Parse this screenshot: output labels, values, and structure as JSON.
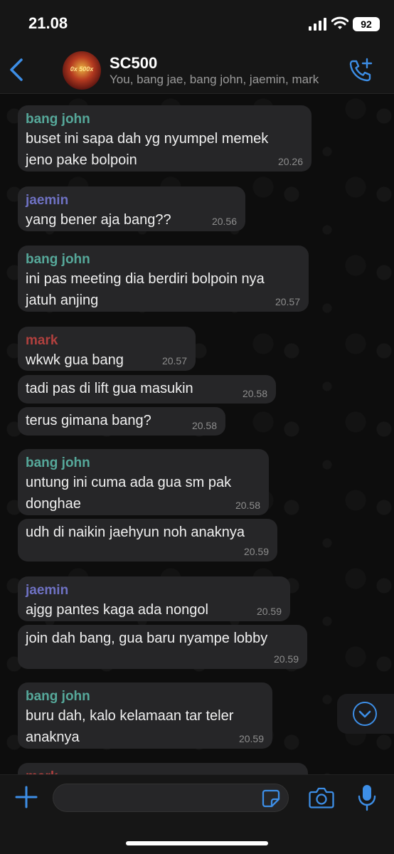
{
  "status_bar": {
    "time": "21.08",
    "battery": "92"
  },
  "header": {
    "back_icon": "chevron-left-icon",
    "avatar_text": "0x 500x",
    "title": "SC500",
    "members": "You, bang jae, bang john, jaemin, mark",
    "call_icon": "phone-plus-icon"
  },
  "messages": [
    {
      "sender": "bang john",
      "lines": [
        "buset ini sapa dah yg nyumpel memek",
        "jeno pake bolpoin"
      ],
      "time": "20.26"
    },
    {
      "sender": "jaemin",
      "lines": [
        "yang bener aja bang??"
      ],
      "time": "20.56"
    },
    {
      "sender": "bang john",
      "lines": [
        "ini pas meeting dia berdiri bolpoin nya",
        "jatuh anjing"
      ],
      "time": "20.57"
    },
    {
      "sender": "mark",
      "lines": [
        "wkwk gua bang"
      ],
      "time": "20.57"
    },
    {
      "sender": "",
      "lines": [
        "tadi pas di lift gua masukin"
      ],
      "time": "20.58"
    },
    {
      "sender": "",
      "lines": [
        "terus gimana bang?"
      ],
      "time": "20.58"
    },
    {
      "sender": "bang john",
      "lines": [
        "untung ini cuma ada gua sm pak",
        "donghae"
      ],
      "time": "20.58"
    },
    {
      "sender": "",
      "lines": [
        "udh di naikin jaehyun noh anaknya"
      ],
      "time": "20.59"
    },
    {
      "sender": "jaemin",
      "lines": [
        "ajgg pantes kaga ada nongol"
      ],
      "time": "20.59"
    },
    {
      "sender": "",
      "lines": [
        "join dah bang, gua baru nyampe lobby"
      ],
      "time": "20.59"
    },
    {
      "sender": "bang john",
      "lines": [
        "buru dah, kalo kelamaan tar teler",
        "anaknya"
      ],
      "time": "20.59"
    },
    {
      "sender": "mark",
      "lines": [],
      "time": ""
    }
  ],
  "input": {
    "value": "",
    "placeholder": ""
  },
  "colors": {
    "accent": "#3d8ee6",
    "bang_john": "#56a89a",
    "jaemin": "#6f72c4",
    "mark": "#b0403e"
  }
}
